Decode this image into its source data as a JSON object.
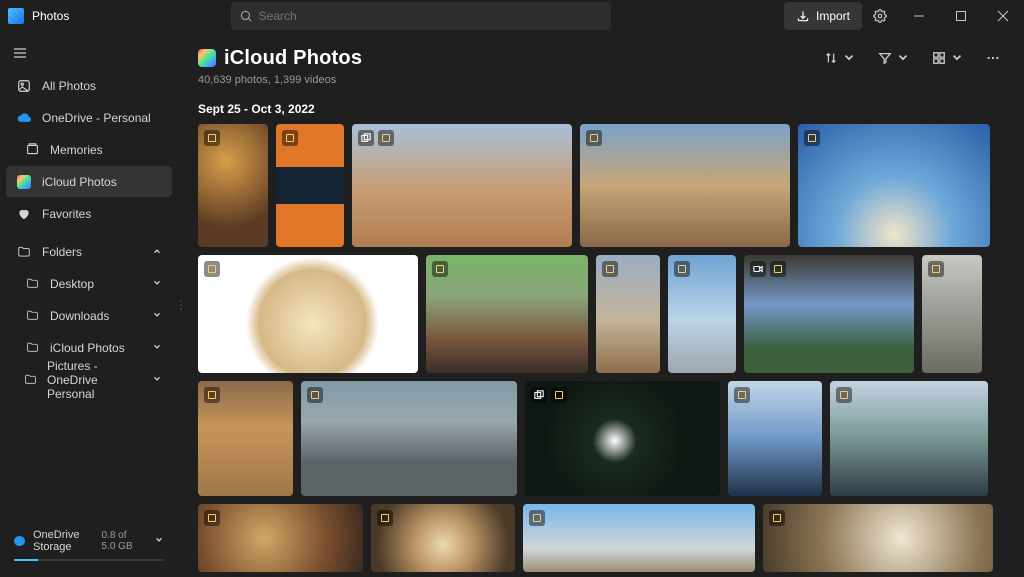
{
  "app": {
    "name": "Photos"
  },
  "search": {
    "placeholder": "Search"
  },
  "import": {
    "label": "Import"
  },
  "sidebar": {
    "all_photos": "All Photos",
    "onedrive": "OneDrive - Personal",
    "memories": "Memories",
    "icloud": "iCloud Photos",
    "favorites": "Favorites",
    "folders_label": "Folders",
    "folders": [
      {
        "label": "Desktop"
      },
      {
        "label": "Downloads"
      },
      {
        "label": "iCloud Photos"
      },
      {
        "label": "Pictures - OneDrive Personal"
      }
    ]
  },
  "storage": {
    "label": "OneDrive Storage",
    "usage": "0.8 of 5.0 GB",
    "percent": 16
  },
  "page": {
    "title": "iCloud Photos",
    "counts": "40,639 photos, 1,399 videos",
    "date_heading": "Sept 25 - Oct 3, 2022"
  }
}
